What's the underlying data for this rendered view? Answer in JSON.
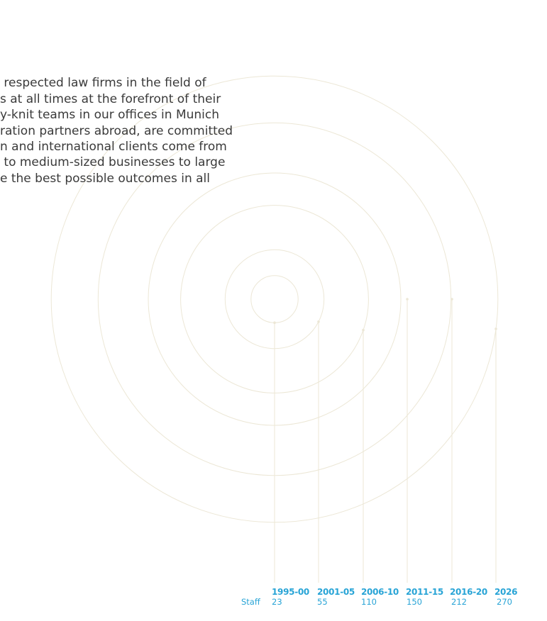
{
  "intro": {
    "lines": [
      " respected law firms in the field of",
      "s at all times at the forefront of their",
      "y-knit teams in our offices in Munich",
      "ration partners abroad, are committed",
      "n and international clients come from",
      " to medium-sized businesses to large",
      "e the best possible outcomes in all"
    ]
  },
  "colors": {
    "accent": "#28a4d6",
    "ring": "#ece7d6",
    "body_text": "#3a3a3a"
  },
  "chart_data": {
    "type": "line",
    "ylabel": "Staff",
    "categories": [
      "1995-00",
      "2001-05",
      "2006-10",
      "2011-15",
      "2016-20",
      "2026"
    ],
    "values": [
      23,
      55,
      110,
      150,
      212,
      270
    ]
  }
}
